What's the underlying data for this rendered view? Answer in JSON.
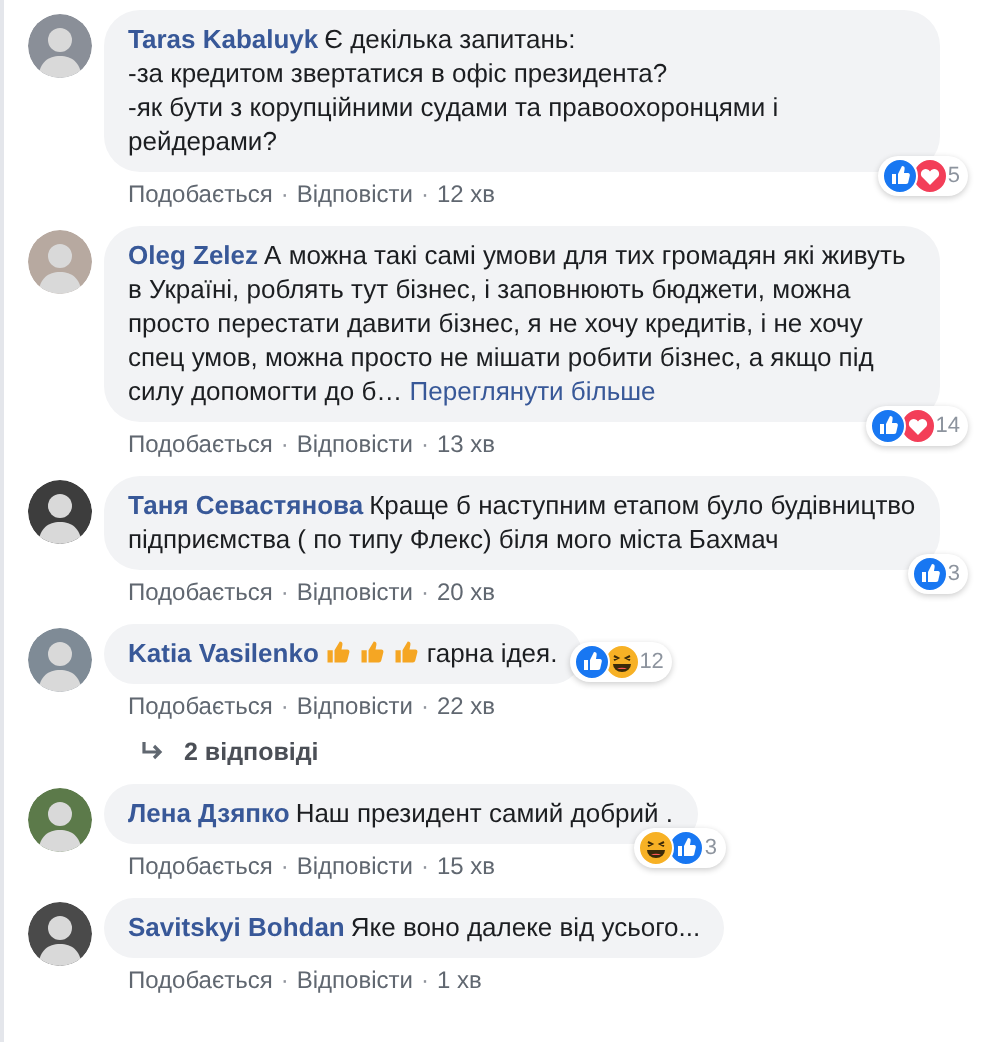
{
  "comments": [
    {
      "author": "Taras Kabaluyk",
      "lines": [
        "Є декілька запитань:",
        "-за кредитом звертатися в офіс президента?",
        "-як бути з корупційними судами та правоохоронцями і рейдерами?"
      ],
      "actions": [
        "Подобається",
        "Відповісти"
      ],
      "separator": "·",
      "time": "12 хв",
      "reactions": [
        {
          "kind": "like"
        },
        {
          "kind": "love"
        }
      ],
      "reaction_count": "5",
      "reactions_beside": false
    },
    {
      "author": "Oleg Zelez",
      "lines": [
        "А можна такі самі умови для тих громадян які живуть в Україні, роблять тут бізнес, і заповнюють бюджети, можна просто перестати давити бізнес, я не хочу кредитів, і не хочу спец умов, можна просто не мішати робити бізнес, а якщо під силу допомогти до б…"
      ],
      "see_more": "Переглянути більше",
      "actions": [
        "Подобається",
        "Відповісти"
      ],
      "separator": "·",
      "time": "13 хв",
      "reactions": [
        {
          "kind": "like"
        },
        {
          "kind": "love"
        }
      ],
      "reaction_count": "14",
      "reactions_beside": false
    },
    {
      "author": "Таня Севастянова",
      "lines": [
        "Краще б наступним етапом було будівництво підприємства ( по типу Флекс) біля мого міста Бахмач"
      ],
      "actions": [
        "Подобається",
        "Відповісти"
      ],
      "separator": "·",
      "time": "20 хв",
      "reactions": [
        {
          "kind": "like"
        }
      ],
      "reaction_count": "3",
      "reactions_beside": false
    },
    {
      "author": "Katia Vasilenko",
      "lines": [
        "гарна ідея."
      ],
      "inline": [
        {
          "kind": "thumb"
        },
        {
          "kind": "thumb"
        },
        {
          "kind": "thumb"
        }
      ],
      "actions": [
        "Подобається",
        "Відповісти"
      ],
      "separator": "·",
      "time": "22 хв",
      "reactions": [
        {
          "kind": "like"
        },
        {
          "kind": "haha"
        }
      ],
      "reaction_count": "12",
      "reactions_beside": true,
      "replies": "2 відповіді"
    },
    {
      "author": "Лена Дзяпко",
      "lines": [
        "Наш президент самий добрий ."
      ],
      "actions": [
        "Подобається",
        "Відповісти"
      ],
      "separator": "·",
      "time": "15 хв",
      "reactions": [
        {
          "kind": "haha"
        },
        {
          "kind": "like"
        }
      ],
      "reaction_count": "3",
      "reactions_beside": false
    },
    {
      "author": "Savitskyi Bohdan",
      "lines": [
        "Яке воно далеке від усього..."
      ],
      "actions": [
        "Подобається",
        "Відповісти"
      ],
      "separator": "·",
      "time": "1 хв"
    }
  ]
}
